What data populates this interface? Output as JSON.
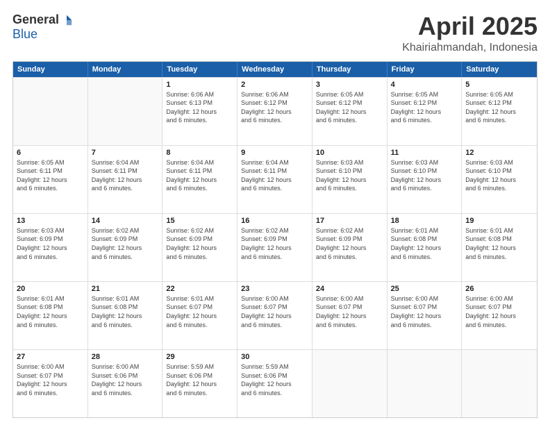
{
  "logo": {
    "general": "General",
    "blue": "Blue"
  },
  "header": {
    "title": "April 2025",
    "subtitle": "Khairiahmandah, Indonesia"
  },
  "calendar": {
    "days": [
      "Sunday",
      "Monday",
      "Tuesday",
      "Wednesday",
      "Thursday",
      "Friday",
      "Saturday"
    ],
    "rows": [
      [
        {
          "day": "",
          "info": ""
        },
        {
          "day": "",
          "info": ""
        },
        {
          "day": "1",
          "info": "Sunrise: 6:06 AM\nSunset: 6:13 PM\nDaylight: 12 hours\nand 6 minutes."
        },
        {
          "day": "2",
          "info": "Sunrise: 6:06 AM\nSunset: 6:12 PM\nDaylight: 12 hours\nand 6 minutes."
        },
        {
          "day": "3",
          "info": "Sunrise: 6:05 AM\nSunset: 6:12 PM\nDaylight: 12 hours\nand 6 minutes."
        },
        {
          "day": "4",
          "info": "Sunrise: 6:05 AM\nSunset: 6:12 PM\nDaylight: 12 hours\nand 6 minutes."
        },
        {
          "day": "5",
          "info": "Sunrise: 6:05 AM\nSunset: 6:12 PM\nDaylight: 12 hours\nand 6 minutes."
        }
      ],
      [
        {
          "day": "6",
          "info": "Sunrise: 6:05 AM\nSunset: 6:11 PM\nDaylight: 12 hours\nand 6 minutes."
        },
        {
          "day": "7",
          "info": "Sunrise: 6:04 AM\nSunset: 6:11 PM\nDaylight: 12 hours\nand 6 minutes."
        },
        {
          "day": "8",
          "info": "Sunrise: 6:04 AM\nSunset: 6:11 PM\nDaylight: 12 hours\nand 6 minutes."
        },
        {
          "day": "9",
          "info": "Sunrise: 6:04 AM\nSunset: 6:11 PM\nDaylight: 12 hours\nand 6 minutes."
        },
        {
          "day": "10",
          "info": "Sunrise: 6:03 AM\nSunset: 6:10 PM\nDaylight: 12 hours\nand 6 minutes."
        },
        {
          "day": "11",
          "info": "Sunrise: 6:03 AM\nSunset: 6:10 PM\nDaylight: 12 hours\nand 6 minutes."
        },
        {
          "day": "12",
          "info": "Sunrise: 6:03 AM\nSunset: 6:10 PM\nDaylight: 12 hours\nand 6 minutes."
        }
      ],
      [
        {
          "day": "13",
          "info": "Sunrise: 6:03 AM\nSunset: 6:09 PM\nDaylight: 12 hours\nand 6 minutes."
        },
        {
          "day": "14",
          "info": "Sunrise: 6:02 AM\nSunset: 6:09 PM\nDaylight: 12 hours\nand 6 minutes."
        },
        {
          "day": "15",
          "info": "Sunrise: 6:02 AM\nSunset: 6:09 PM\nDaylight: 12 hours\nand 6 minutes."
        },
        {
          "day": "16",
          "info": "Sunrise: 6:02 AM\nSunset: 6:09 PM\nDaylight: 12 hours\nand 6 minutes."
        },
        {
          "day": "17",
          "info": "Sunrise: 6:02 AM\nSunset: 6:09 PM\nDaylight: 12 hours\nand 6 minutes."
        },
        {
          "day": "18",
          "info": "Sunrise: 6:01 AM\nSunset: 6:08 PM\nDaylight: 12 hours\nand 6 minutes."
        },
        {
          "day": "19",
          "info": "Sunrise: 6:01 AM\nSunset: 6:08 PM\nDaylight: 12 hours\nand 6 minutes."
        }
      ],
      [
        {
          "day": "20",
          "info": "Sunrise: 6:01 AM\nSunset: 6:08 PM\nDaylight: 12 hours\nand 6 minutes."
        },
        {
          "day": "21",
          "info": "Sunrise: 6:01 AM\nSunset: 6:08 PM\nDaylight: 12 hours\nand 6 minutes."
        },
        {
          "day": "22",
          "info": "Sunrise: 6:01 AM\nSunset: 6:07 PM\nDaylight: 12 hours\nand 6 minutes."
        },
        {
          "day": "23",
          "info": "Sunrise: 6:00 AM\nSunset: 6:07 PM\nDaylight: 12 hours\nand 6 minutes."
        },
        {
          "day": "24",
          "info": "Sunrise: 6:00 AM\nSunset: 6:07 PM\nDaylight: 12 hours\nand 6 minutes."
        },
        {
          "day": "25",
          "info": "Sunrise: 6:00 AM\nSunset: 6:07 PM\nDaylight: 12 hours\nand 6 minutes."
        },
        {
          "day": "26",
          "info": "Sunrise: 6:00 AM\nSunset: 6:07 PM\nDaylight: 12 hours\nand 6 minutes."
        }
      ],
      [
        {
          "day": "27",
          "info": "Sunrise: 6:00 AM\nSunset: 6:07 PM\nDaylight: 12 hours\nand 6 minutes."
        },
        {
          "day": "28",
          "info": "Sunrise: 6:00 AM\nSunset: 6:06 PM\nDaylight: 12 hours\nand 6 minutes."
        },
        {
          "day": "29",
          "info": "Sunrise: 5:59 AM\nSunset: 6:06 PM\nDaylight: 12 hours\nand 6 minutes."
        },
        {
          "day": "30",
          "info": "Sunrise: 5:59 AM\nSunset: 6:06 PM\nDaylight: 12 hours\nand 6 minutes."
        },
        {
          "day": "",
          "info": ""
        },
        {
          "day": "",
          "info": ""
        },
        {
          "day": "",
          "info": ""
        }
      ]
    ]
  }
}
